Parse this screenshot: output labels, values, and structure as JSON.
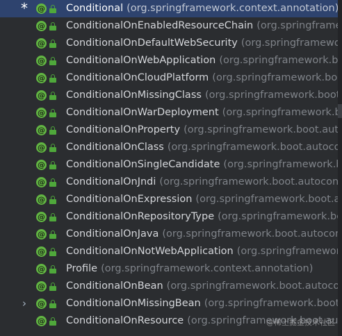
{
  "tree": {
    "rows": [
      {
        "name": "Conditional",
        "package": "(org.springframework.context.annotation)",
        "toggle": "*",
        "selected": true
      },
      {
        "name": "ConditionalOnEnabledResourceChain",
        "package": "(org.springframework.boot.autoconfigure.web)",
        "toggle": ""
      },
      {
        "name": "ConditionalOnDefaultWebSecurity",
        "package": "(org.springframework.boot.autoconfigure.security)",
        "toggle": ""
      },
      {
        "name": "ConditionalOnWebApplication",
        "package": "(org.springframework.boot.autoconfigure.condition)",
        "toggle": ""
      },
      {
        "name": "ConditionalOnCloudPlatform",
        "package": "(org.springframework.boot.autoconfigure.condition)",
        "toggle": ""
      },
      {
        "name": "ConditionalOnMissingClass",
        "package": "(org.springframework.boot.autoconfigure.condition)",
        "toggle": ""
      },
      {
        "name": "ConditionalOnWarDeployment",
        "package": "(org.springframework.boot.autoconfigure.condition)",
        "toggle": ""
      },
      {
        "name": "ConditionalOnProperty",
        "package": "(org.springframework.boot.autoconfigure.condition)",
        "toggle": ""
      },
      {
        "name": "ConditionalOnClass",
        "package": "(org.springframework.boot.autoconfigure.condition)",
        "toggle": ""
      },
      {
        "name": "ConditionalOnSingleCandidate",
        "package": "(org.springframework.boot.autoconfigure.condition)",
        "toggle": ""
      },
      {
        "name": "ConditionalOnJndi",
        "package": "(org.springframework.boot.autoconfigure.condition)",
        "toggle": ""
      },
      {
        "name": "ConditionalOnExpression",
        "package": "(org.springframework.boot.autoconfigure.condition)",
        "toggle": ""
      },
      {
        "name": "ConditionalOnRepositoryType",
        "package": "(org.springframework.boot.autoconfigure.data)",
        "toggle": ""
      },
      {
        "name": "ConditionalOnJava",
        "package": "(org.springframework.boot.autoconfigure.condition)",
        "toggle": ""
      },
      {
        "name": "ConditionalOnNotWebApplication",
        "package": "(org.springframework.boot.autoconfigure.condition)",
        "toggle": ""
      },
      {
        "name": "Profile",
        "package": "(org.springframework.context.annotation)",
        "toggle": ""
      },
      {
        "name": "ConditionalOnBean",
        "package": "(org.springframework.boot.autoconfigure.condition)",
        "toggle": ""
      },
      {
        "name": "ConditionalOnMissingBean",
        "package": "(org.springframework.boot.autoconfigure.condition)",
        "toggle": "›"
      },
      {
        "name": "ConditionalOnResource",
        "package": "(org.springframework.boot.autoconfigure.condition)",
        "toggle": ""
      }
    ],
    "annotation_badge": "@",
    "icons": {
      "annotation": "annotation-icon",
      "access": "lock-icon",
      "expand": "chevron-right-icon"
    }
  },
  "watermark": "@稀土掘金技术社区",
  "colors": {
    "background": "#2b2d30",
    "selection": "#2e436e",
    "annotation": "#62b543",
    "package_text": "#7f8389"
  }
}
